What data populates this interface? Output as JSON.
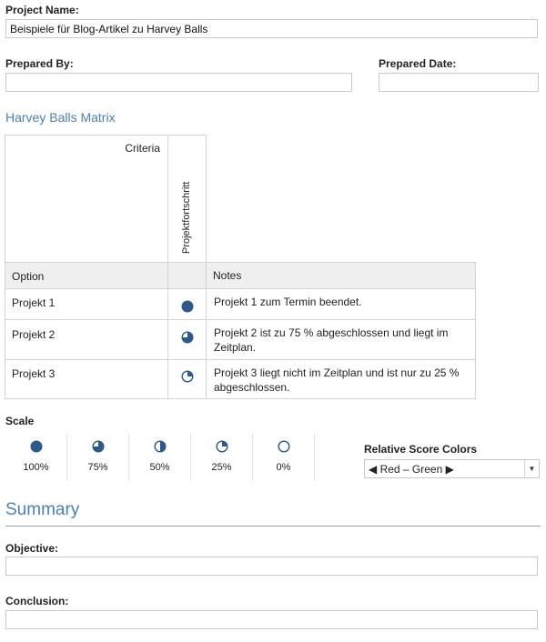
{
  "project": {
    "name_label": "Project Name:",
    "name_value": "Beispiele für Blog-Artikel zu Harvey Balls",
    "prepared_by_label": "Prepared By:",
    "prepared_by_value": "",
    "prepared_date_label": "Prepared Date:",
    "prepared_date_value": ""
  },
  "matrix": {
    "title": "Harvey Balls Matrix",
    "criteria_label": "Criteria",
    "column_header": "Projektfortschritt",
    "option_header": "Option",
    "notes_header": "Notes",
    "rows": [
      {
        "option": "Projekt 1",
        "fill": 1.0,
        "notes": "Projekt 1 zum Termin beendet."
      },
      {
        "option": "Projekt 2",
        "fill": 0.75,
        "notes": "Projekt 2 ist zu 75 % abgeschlossen und liegt im Zeitplan."
      },
      {
        "option": "Projekt 3",
        "fill": 0.25,
        "notes": "Projekt 3 liegt nicht im Zeitplan und ist nur zu 25 % abgeschlossen."
      }
    ]
  },
  "scale": {
    "label": "Scale",
    "items": [
      {
        "fill": 1.0,
        "label": "100%"
      },
      {
        "fill": 0.75,
        "label": "75%"
      },
      {
        "fill": 0.5,
        "label": "50%"
      },
      {
        "fill": 0.25,
        "label": "25%"
      },
      {
        "fill": 0.0,
        "label": "0%"
      }
    ]
  },
  "score_colors": {
    "label": "Relative Score Colors",
    "selected": "◀ Red – Green ▶"
  },
  "summary": {
    "title": "Summary",
    "objective_label": "Objective:",
    "objective_value": "",
    "conclusion_label": "Conclusion:",
    "conclusion_value": ""
  },
  "colors": {
    "ball": "#2d5a8c",
    "accent": "#4a7fb5"
  }
}
